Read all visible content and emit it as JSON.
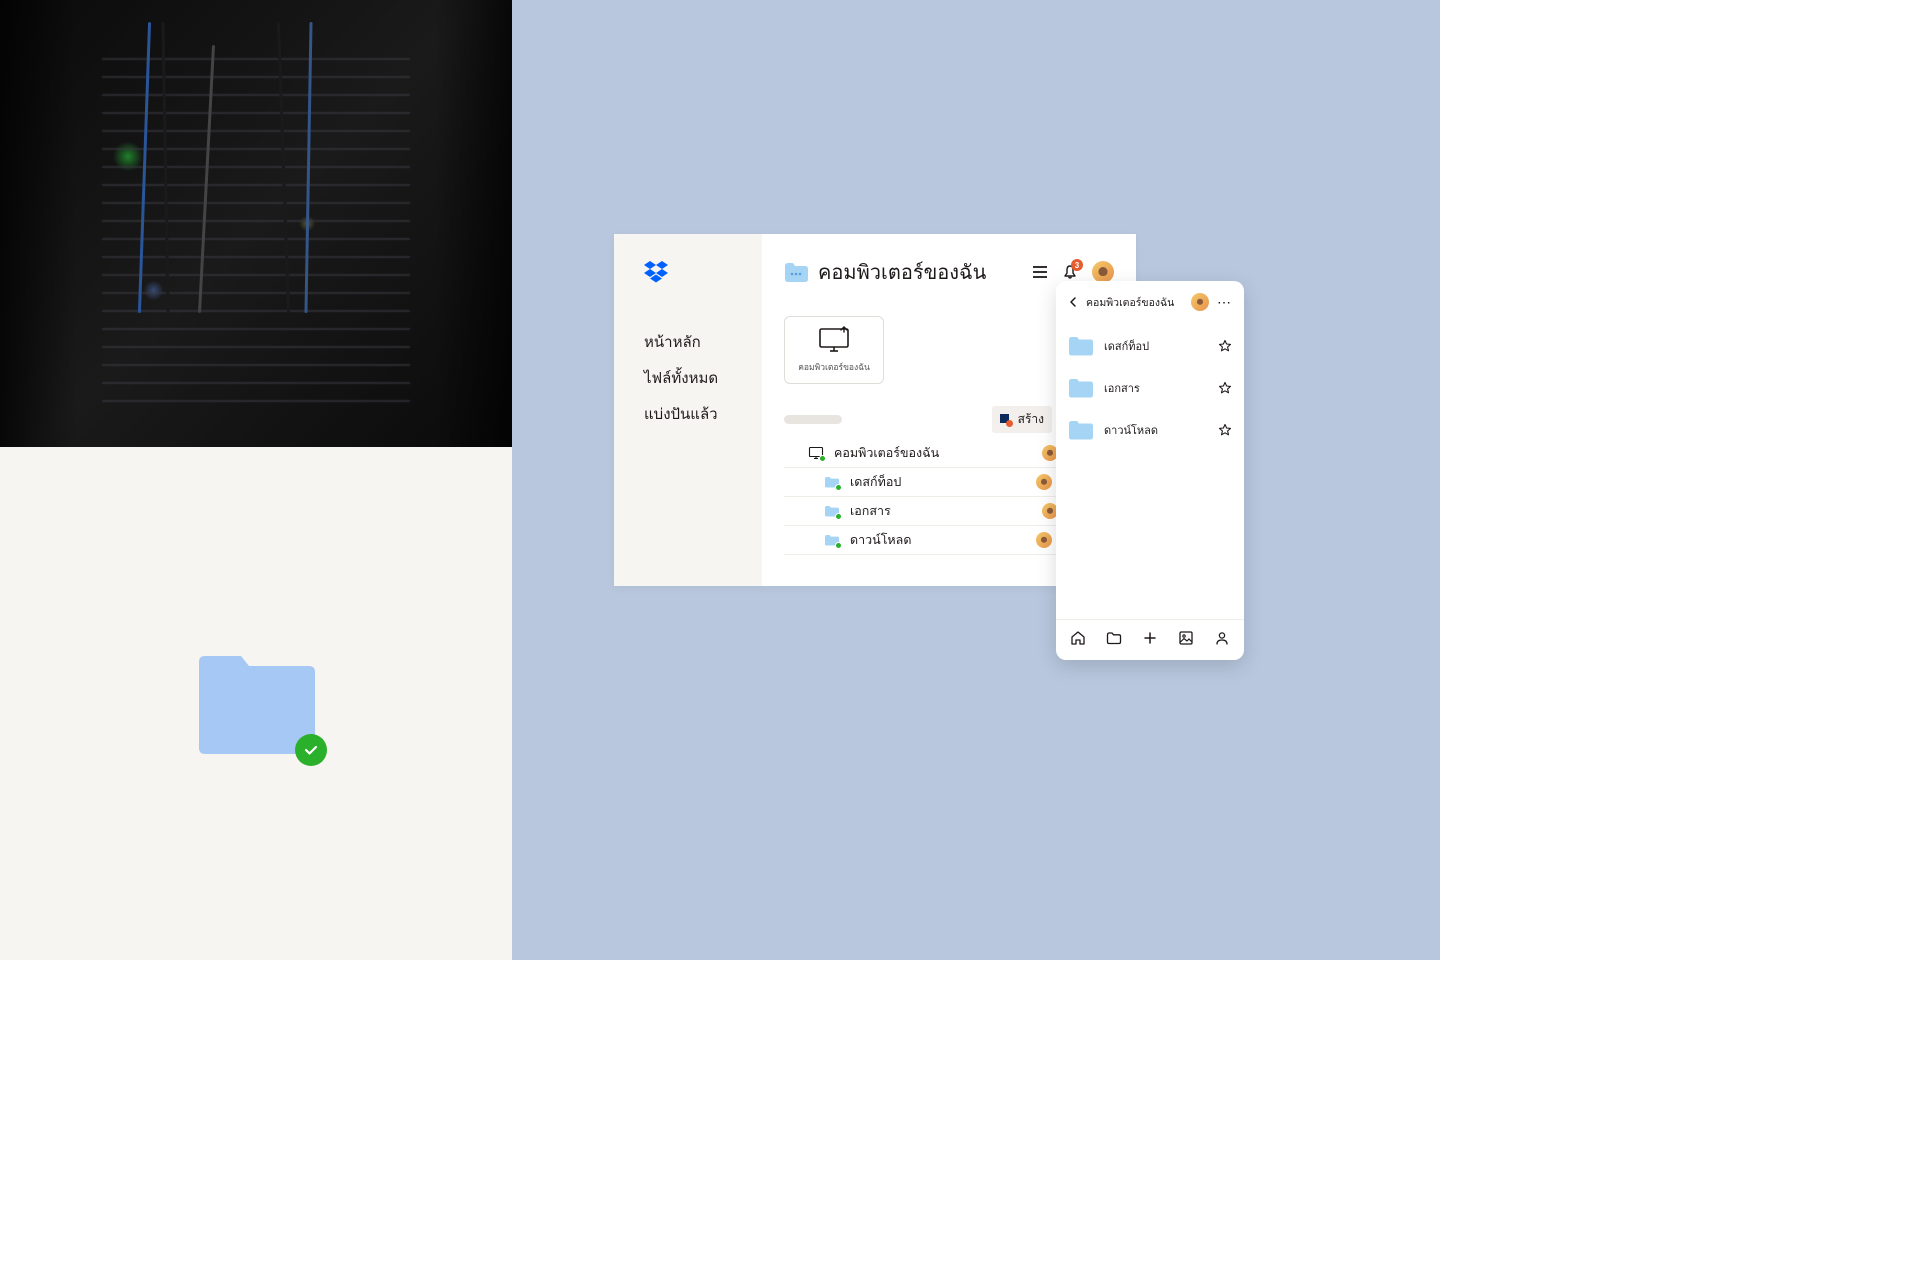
{
  "sidebar": {
    "nav": [
      {
        "label": "หน้าหลัก"
      },
      {
        "label": "ไฟล์ทั้งหมด"
      },
      {
        "label": "แบ่งปันแล้ว"
      }
    ]
  },
  "main": {
    "title": "คอมพิวเตอร์ของฉัน",
    "bell_badge": "3",
    "computer_card_label": "คอมพิวเตอร์ของฉัน",
    "create_label": "สร้าง",
    "files": [
      {
        "name": "คอมพิวเตอร์ของฉัน",
        "type": "computer",
        "indent": 1
      },
      {
        "name": "เดสก์ท็อป",
        "type": "folder",
        "indent": 2
      },
      {
        "name": "เอกสาร",
        "type": "folder",
        "indent": 2
      },
      {
        "name": "ดาวน์โหลด",
        "type": "folder",
        "indent": 2
      }
    ]
  },
  "mobile": {
    "title": "คอมพิวเตอร์ของฉัน",
    "items": [
      {
        "label": "เดสก์ท็อป"
      },
      {
        "label": "เอกสาร"
      },
      {
        "label": "ดาวน์โหลด"
      }
    ]
  }
}
